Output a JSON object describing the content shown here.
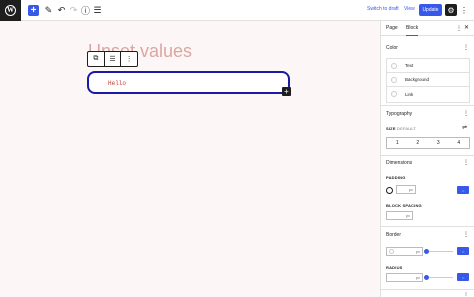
{
  "toolbar": {
    "switch_to_draft": "Switch to draft",
    "view": "View",
    "update": "Update"
  },
  "canvas": {
    "page_title": "Unset values",
    "block_text": "Hello"
  },
  "sidebar": {
    "tabs": [
      "Page",
      "Block"
    ],
    "color": {
      "title": "Color",
      "items": [
        "Text",
        "Background",
        "Link"
      ]
    },
    "typography": {
      "title": "Typography",
      "size_label": "SIZE",
      "size_sub": "DEFAULT",
      "size_options": [
        "1",
        "2",
        "3",
        "4"
      ]
    },
    "dimensions": {
      "title": "Dimensions",
      "padding_label": "PADDING",
      "padding_unit": "px",
      "block_spacing_label": "BLOCK SPACING",
      "block_spacing_unit": "px"
    },
    "border": {
      "title": "Border",
      "border_unit": "px",
      "radius_label": "RADIUS",
      "radius_unit": "px"
    }
  },
  "icons": {
    "wordpress": "wordpress-logo-icon",
    "add": "plus-icon",
    "edit": "pencil-icon",
    "undo": "undo-icon",
    "redo": "redo-icon",
    "details": "info-icon",
    "outline": "list-view-icon",
    "settings": "settings-icon",
    "options": "kebab-menu-icon"
  },
  "colors": {
    "accent": "#3858e9",
    "block_border": "#1a1aa6",
    "canvas_bg": "#fdf6f6",
    "title_color": "#d9a7a2",
    "code_color": "#c0392b"
  }
}
